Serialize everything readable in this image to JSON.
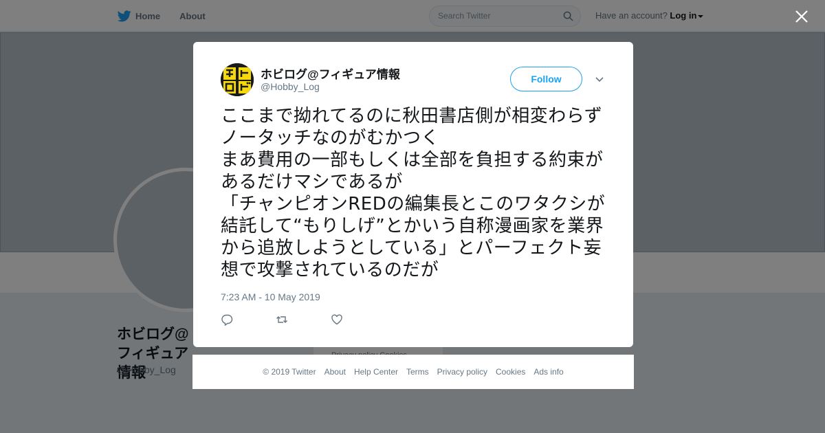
{
  "nav": {
    "home_label": "Home",
    "about_label": "About",
    "search_placeholder": "Search Twitter",
    "account_prompt": "Have an account?",
    "login_label": "Log in"
  },
  "profile_background": {
    "name": "ホビログ@フィギュア情報",
    "handle": "@Hobby_Log",
    "footer_partial": "Privacy policy   Cookies"
  },
  "tweet": {
    "author_name": "ホビログ@フィギュア情報",
    "author_handle": "@Hobby_Log",
    "follow_label": "Follow",
    "text": "ここまで拗れてるのに秋田書店側が相変わらずノータッチなのがむかつく\nまあ費用の一部もしくは全部を負担する約束があるだけマシであるが\n「チャンピオンREDの編集長とこのワタクシが結託して“もりしげ”とかいう自称漫画家を業界から追放しようとしている」とパーフェクト妄想で攻撃されているのだが",
    "timestamp": "7:23 AM - 10 May 2019"
  },
  "footer": {
    "copyright": "© 2019 Twitter",
    "links": [
      "About",
      "Help Center",
      "Terms",
      "Privacy policy",
      "Cookies",
      "Ads info"
    ]
  },
  "colors": {
    "twitter_blue": "#1da1f2",
    "overlay": "rgba(0,0,0,0.5)",
    "text_secondary": "#657786"
  },
  "icons": [
    "twitter-bird-icon",
    "search-icon",
    "close-icon",
    "chevron-down-icon",
    "reply-icon",
    "retweet-icon",
    "like-icon"
  ]
}
